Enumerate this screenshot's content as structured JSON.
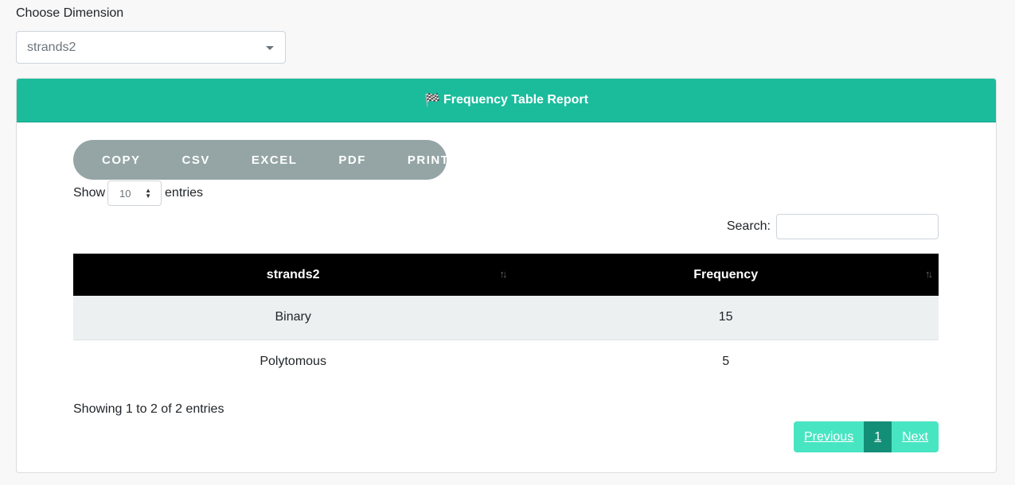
{
  "dimension": {
    "label": "Choose Dimension",
    "selected": "strands2"
  },
  "card": {
    "title": "Frequency Table Report",
    "icon": "checkered-flag-icon",
    "accent_color": "#1abc9c"
  },
  "export_buttons": [
    "COPY",
    "CSV",
    "EXCEL",
    "PDF",
    "PRINT"
  ],
  "length": {
    "prefix": "Show",
    "value": "10",
    "suffix": "entries"
  },
  "search": {
    "label": "Search:",
    "value": ""
  },
  "table": {
    "columns": [
      "strands2",
      "Frequency"
    ],
    "rows": [
      [
        "Binary",
        "15"
      ],
      [
        "Polytomous",
        "5"
      ]
    ]
  },
  "info": "Showing 1 to 2 of 2 entries",
  "pagination": {
    "previous": "Previous",
    "current": "1",
    "next": "Next"
  }
}
